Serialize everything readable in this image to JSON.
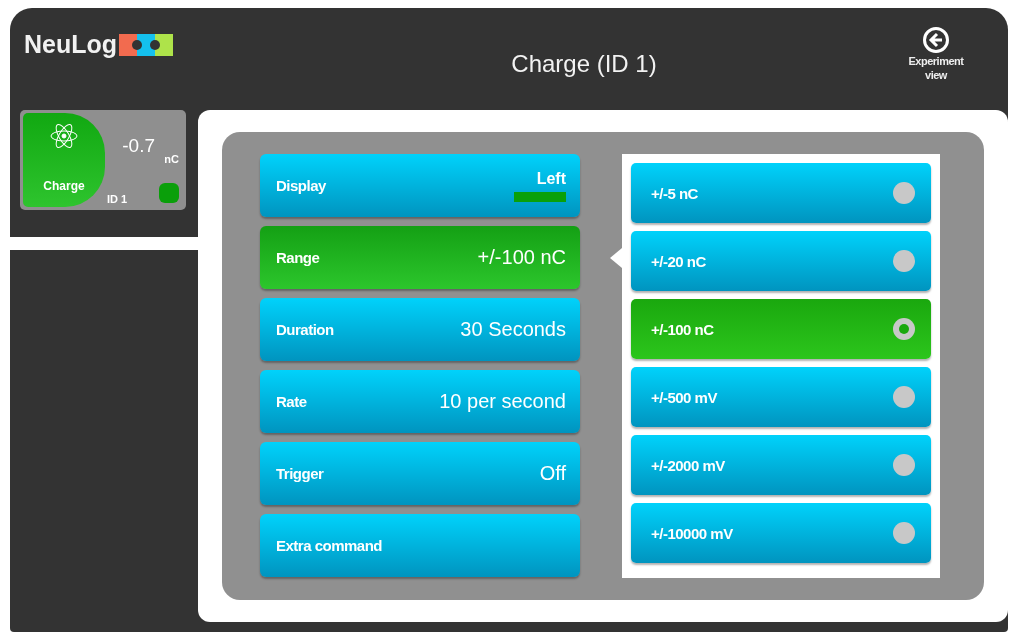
{
  "header": {
    "logo": "NeuLog",
    "title": "Charge (ID 1)",
    "back_button": "Experiment view"
  },
  "sensor": {
    "name": "Charge",
    "value": "-0.7",
    "unit": "nC",
    "id": "ID 1"
  },
  "settings": [
    {
      "kind": "display",
      "label": "Display",
      "value": "Left",
      "selected": false
    },
    {
      "kind": "plain",
      "label": "Range",
      "value": "+/-100 nC",
      "selected": true
    },
    {
      "kind": "plain",
      "label": "Duration",
      "value": "30 Seconds",
      "selected": false
    },
    {
      "kind": "plain",
      "label": "Rate",
      "value": "10 per second",
      "selected": false
    },
    {
      "kind": "plain",
      "label": "Trigger",
      "value": "Off",
      "selected": false
    },
    {
      "kind": "plain",
      "label": "Extra command",
      "selected": false
    }
  ],
  "options": [
    {
      "label": "+/-5 nC",
      "selected": false
    },
    {
      "label": "+/-20 nC",
      "selected": false
    },
    {
      "label": "+/-100 nC",
      "selected": true
    },
    {
      "label": "+/-500 mV",
      "selected": false
    },
    {
      "label": "+/-2000 mV",
      "selected": false
    },
    {
      "label": "+/-10000 mV",
      "selected": false
    }
  ]
}
